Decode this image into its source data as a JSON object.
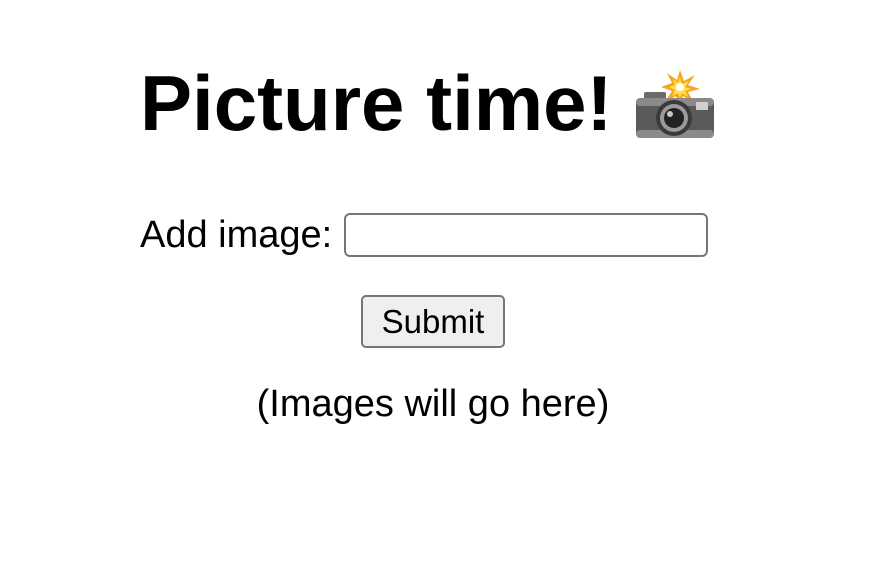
{
  "header": {
    "title": "Picture time!",
    "title_icon": "camera-with-flash-icon"
  },
  "form": {
    "label": "Add image:",
    "input_value": "",
    "input_placeholder": "",
    "submit_label": "Submit"
  },
  "gallery": {
    "empty_text": "(Images will go here)"
  },
  "colors": {
    "text": "#000000",
    "background": "#ffffff",
    "button_background": "#efefef",
    "control_border": "#767676"
  }
}
